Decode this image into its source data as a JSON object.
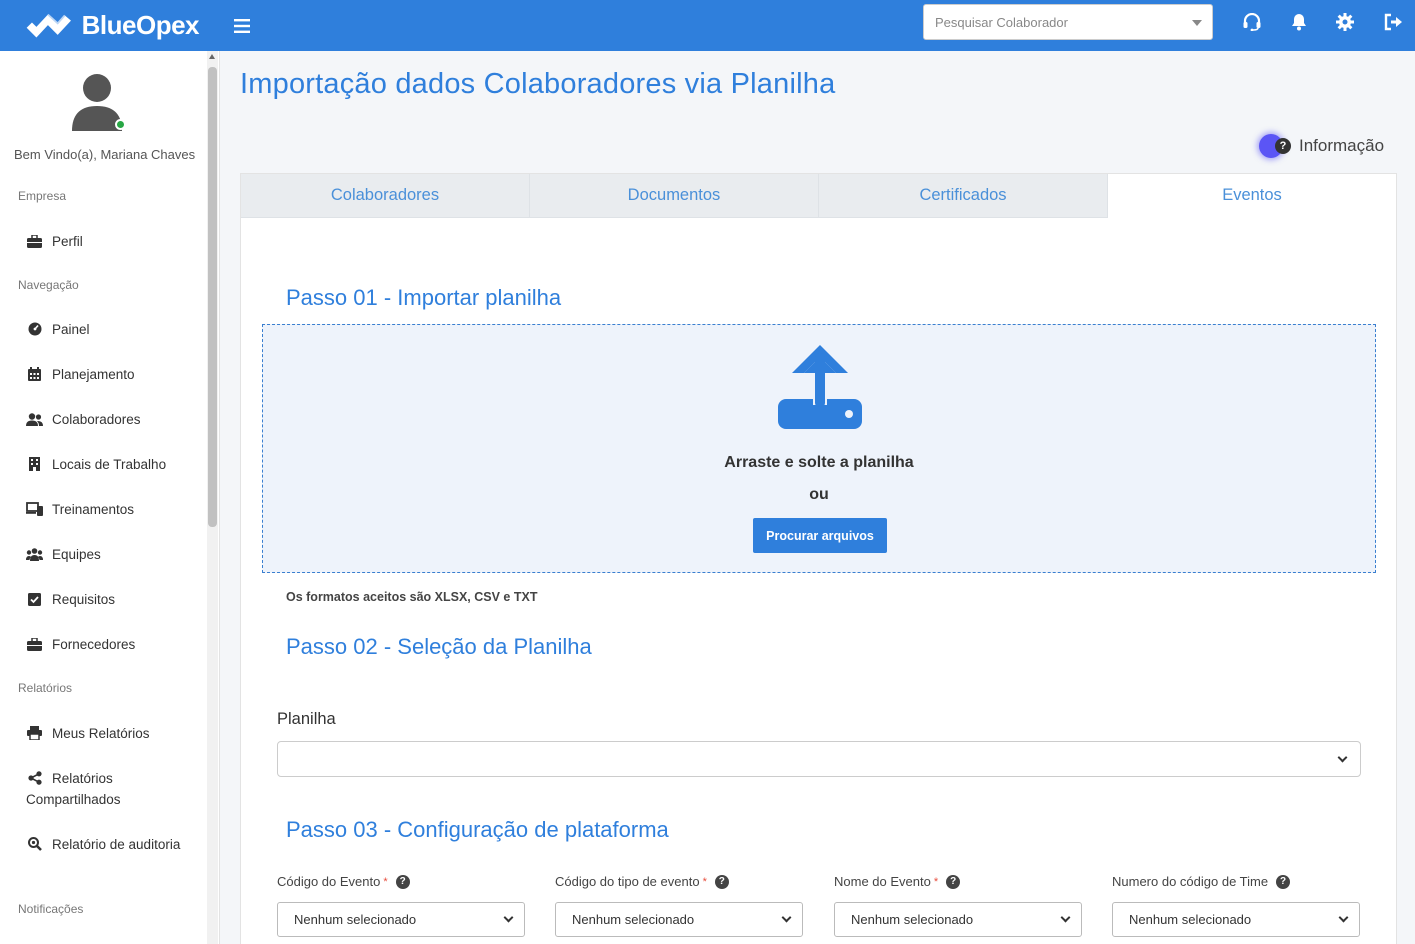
{
  "app": {
    "brand": "BlueOpex",
    "search_placeholder": "Pesquisar Colaborador"
  },
  "sidebar": {
    "welcome": "Bem Vindo(a), Mariana Chaves",
    "sections": {
      "empresa": "Empresa",
      "navegacao": "Navegação",
      "relatorios": "Relatórios",
      "notificacoes": "Notificações"
    },
    "items": {
      "perfil": "Perfil",
      "painel": "Painel",
      "planejamento": "Planejamento",
      "colaboradores": "Colaboradores",
      "locais": "Locais de Trabalho",
      "treinamentos": "Treinamentos",
      "equipes": "Equipes",
      "requisitos": "Requisitos",
      "fornecedores": "Fornecedores",
      "meus_relatorios": "Meus Relatórios",
      "relatorios_compartilhados": "Relatórios Compartilhados",
      "relatorio_auditoria": "Relatório de auditoria"
    }
  },
  "main": {
    "title": "Importação dados Colaboradores via Planilha",
    "info_label": "Informação",
    "info_q": "?",
    "tabs": [
      "Colaboradores",
      "Documentos",
      "Certificados",
      "Eventos"
    ],
    "active_tab": "Eventos",
    "step1": {
      "title": "Passo 01 - Importar planilha",
      "drop_text": "Arraste e solte a planilha",
      "or_text": "ou",
      "browse_button": "Procurar arquivos",
      "formats": "Os formatos aceitos são XLSX, CSV e TXT"
    },
    "step2": {
      "title": "Passo 02 - Seleção da Planilha",
      "label": "Planilha",
      "value": ""
    },
    "step3": {
      "title": "Passo 03 - Configuração de plataforma",
      "fields": [
        {
          "label": "Código do Evento",
          "required": "*",
          "value": "Nenhum selecionado"
        },
        {
          "label": "Código do tipo de evento",
          "required": "*",
          "value": "Nenhum selecionado"
        },
        {
          "label": "Nome do Evento",
          "required": "*",
          "value": "Nenhum selecionado"
        },
        {
          "label": "Numero do código de Time",
          "required": "",
          "value": "Nenhum selecionado"
        }
      ],
      "help_glyph": "?"
    }
  },
  "colors": {
    "primary": "#2f7fdc",
    "online": "#28a745",
    "required": "#e74c3c",
    "info_dot": "#5b55f5"
  }
}
